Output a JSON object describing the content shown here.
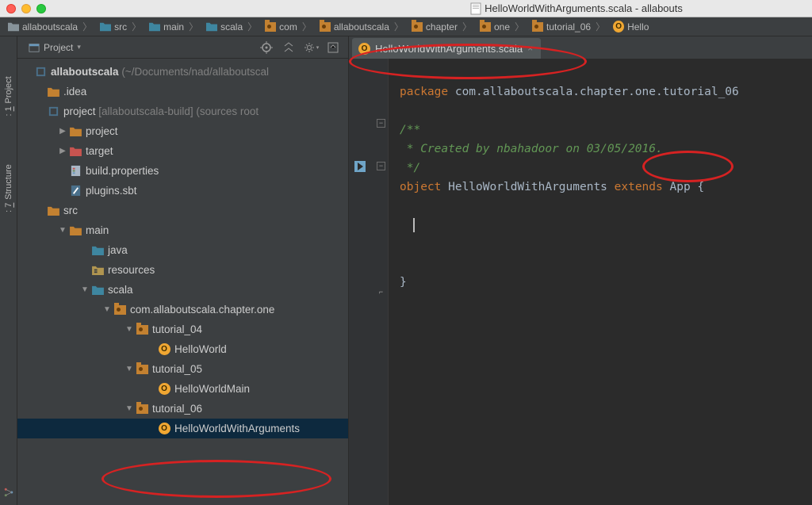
{
  "titlebar": {
    "title": "HelloWorldWithArguments.scala - allabouts"
  },
  "breadcrumbs": [
    {
      "icon": "folder",
      "label": "allaboutscala"
    },
    {
      "icon": "folder-blue",
      "label": "src"
    },
    {
      "icon": "folder-blue",
      "label": "main"
    },
    {
      "icon": "folder-blue",
      "label": "scala"
    },
    {
      "icon": "package",
      "label": "com"
    },
    {
      "icon": "package",
      "label": "allaboutscala"
    },
    {
      "icon": "package",
      "label": "chapter"
    },
    {
      "icon": "package",
      "label": "one"
    },
    {
      "icon": "package",
      "label": "tutorial_06"
    },
    {
      "icon": "object",
      "label": "Hello"
    }
  ],
  "side_tabs": {
    "project": {
      "num": "1",
      "label": "Project"
    },
    "structure": {
      "num": "7",
      "label": "Structure"
    }
  },
  "panel": {
    "title_label": "Project"
  },
  "tree": {
    "root": {
      "label": "allaboutscala",
      "hint": "(~/Documents/nad/allaboutscal"
    },
    "idea": {
      "label": ".idea"
    },
    "project": {
      "label": "project",
      "bracket": "[allaboutscala-build]",
      "hint": "(sources root"
    },
    "project_folder": {
      "label": "project"
    },
    "target": {
      "label": "target"
    },
    "build_props": {
      "label": "build.properties"
    },
    "plugins_sbt": {
      "label": "plugins.sbt"
    },
    "src": {
      "label": "src"
    },
    "main": {
      "label": "main"
    },
    "java": {
      "label": "java"
    },
    "resources": {
      "label": "resources"
    },
    "scala": {
      "label": "scala"
    },
    "pkg_one": {
      "label": "com.allaboutscala.chapter.one"
    },
    "tut04": {
      "label": "tutorial_04"
    },
    "hello_world": {
      "label": "HelloWorld"
    },
    "tut05": {
      "label": "tutorial_05"
    },
    "hello_main": {
      "label": "HelloWorldMain"
    },
    "tut06": {
      "label": "tutorial_06"
    },
    "hello_args": {
      "label": "HelloWorldWithArguments"
    }
  },
  "editor": {
    "tab_label": "HelloWorldWithArguments.scala",
    "code": {
      "l1a": "package",
      "l1b": " com.allaboutscala.chapter.one.tutorial_06",
      "l3": "/**",
      "l4": " * Created by nbahadoor on 03/05/2016.",
      "l5": " */",
      "l6a": "object",
      "l6b": " HelloWorldWithArguments ",
      "l6c": "extends",
      "l6d": " App {",
      "l10": "}"
    }
  }
}
